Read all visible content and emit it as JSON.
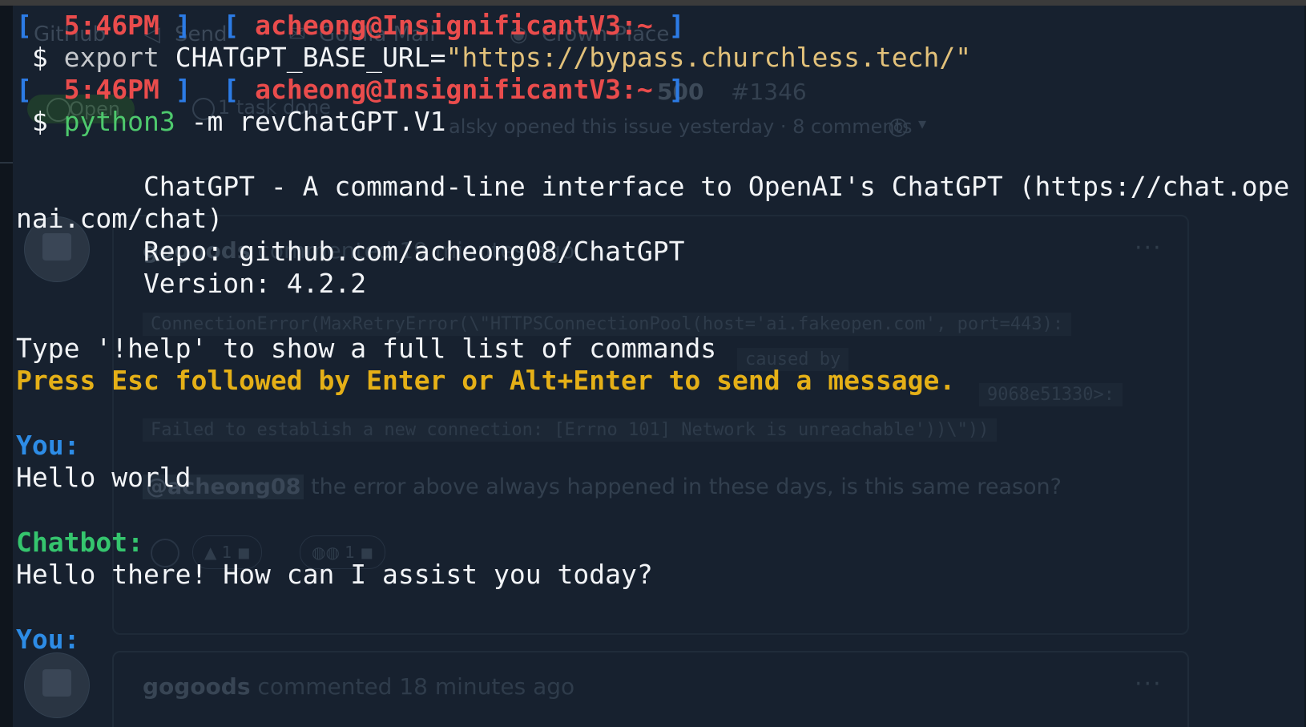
{
  "background_page": {
    "tabs": [
      "GitHub",
      "Send",
      "Gorilla Mail",
      "Crown Place"
    ],
    "issue_title_fragment": "500",
    "issue_number": "#1346",
    "status_pill": "Open",
    "tasks": "1 task done",
    "opened_meta": "alsky opened this issue yesterday · 8 comments",
    "comment1": {
      "author": "gogoods",
      "time": "commented 19 minutes ago",
      "code_lines": [
        "ConnectionError(MaxRetryError(\\\"HTTPSConnectionPool(host='ai.fakeopen.com', port=443):",
        "caused by",
        "9068e51330>:",
        "Failed to establish a new connection: [Errno 101] Network is unreachable'))\\\"))"
      ],
      "mention": "@acheong08",
      "text": "the error above always happened in these days, is this same reason?",
      "reaction_counts": [
        "1",
        "1"
      ]
    },
    "comment2": {
      "author": "gogoods",
      "time": "commented 18 minutes ago"
    },
    "dots": "···"
  },
  "terminal": {
    "prompts": [
      {
        "time": "5:46PM",
        "userhost": "acheong@InsignificantV3:~"
      },
      {
        "time": "5:46PM",
        "userhost": "acheong@InsignificantV3:~"
      }
    ],
    "cmd1": {
      "dollar": "$",
      "keyword": "export",
      "var": "CHATGPT_BASE_URL=",
      "value": "\"https://bypass.churchless.tech/\""
    },
    "cmd2": {
      "dollar": "$",
      "program": "python3",
      "args": "-m revChatGPT.V1"
    },
    "banner": {
      "line1": "        ChatGPT - A command-line interface to OpenAI's ChatGPT (https://chat.ope",
      "line2": "nai.com/chat)",
      "repo": "        Repo: github.com/acheong08/ChatGPT",
      "version": "        Version: 4.2.2"
    },
    "help_line": "Type '!help' to show a full list of commands",
    "esc_line": "Press Esc followed by Enter or Alt+Enter to send a message.",
    "conversation": [
      {
        "label": "You:",
        "text": "Hello world"
      },
      {
        "label": "Chatbot:",
        "text": "Hello there! How can I assist you today?"
      },
      {
        "label": "You:",
        "text": ""
      }
    ]
  },
  "colors": {
    "terminal_bg": "#17212f",
    "prompt_bracket": "#2c7be5",
    "prompt_user": "#ea4c4c",
    "you_label": "#2d8ce6",
    "chatbot_label": "#35c56e",
    "esc_hint": "#e5b017",
    "string": "#e2c17a"
  }
}
